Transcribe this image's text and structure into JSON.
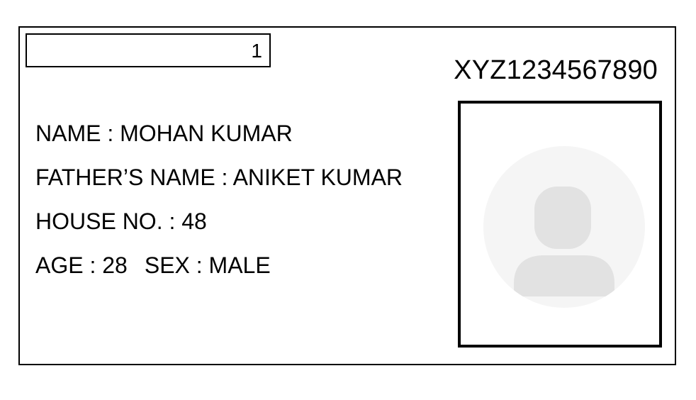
{
  "card": {
    "serial_number": "1",
    "card_id": "XYZ1234567890",
    "name": {
      "label": "NAME",
      "value": "MOHAN KUMAR"
    },
    "father_name": {
      "label": "FATHER’S NAME",
      "value": "ANIKET KUMAR"
    },
    "house_no": {
      "label": "HOUSE NO.",
      "value": "48"
    },
    "age": {
      "label": "AGE",
      "value": "28"
    },
    "sex": {
      "label": "SEX",
      "value": "MALE"
    },
    "separator": " : "
  },
  "photo": {
    "icon": "avatar-placeholder-icon",
    "circle_color": "#f5f5f5",
    "figure_color": "#e2e2e2"
  }
}
